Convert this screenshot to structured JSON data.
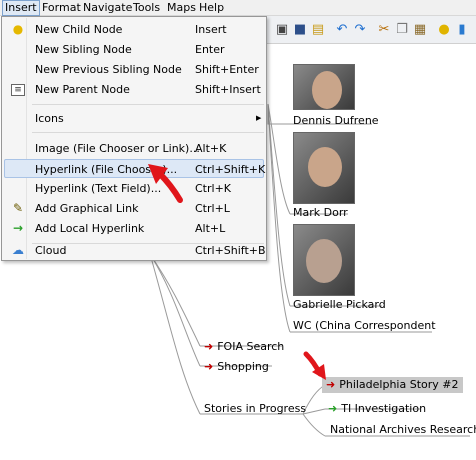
{
  "menubar": {
    "items": [
      "Insert",
      "Format",
      "Navigate",
      "Tools",
      "Maps",
      "Help"
    ]
  },
  "dropdown": {
    "items": [
      {
        "label": "New Child Node",
        "shortcut": "Insert",
        "icon": "lightbulb-icon"
      },
      {
        "label": "New Sibling Node",
        "shortcut": "Enter",
        "icon": ""
      },
      {
        "label": "New Previous Sibling Node",
        "shortcut": "Shift+Enter",
        "icon": ""
      },
      {
        "label": "New Parent Node",
        "shortcut": "Shift+Insert",
        "icon": "parent-node-icon"
      },
      {
        "label": "Icons",
        "shortcut": "",
        "icon": "",
        "submenu": true
      },
      {
        "label": "Image (File Chooser or Link)...",
        "shortcut": "Alt+K",
        "icon": ""
      },
      {
        "label": "Hyperlink (File Chooser)...",
        "shortcut": "Ctrl+Shift+K",
        "icon": "",
        "highlighted": true
      },
      {
        "label": "Hyperlink (Text Field)...",
        "shortcut": "Ctrl+K",
        "icon": ""
      },
      {
        "label": "Add Graphical Link",
        "shortcut": "Ctrl+L",
        "icon": "graphical-link-icon"
      },
      {
        "label": "Add Local Hyperlink",
        "shortcut": "Alt+L",
        "icon": "green-arrow-icon"
      },
      {
        "label": "Cloud",
        "shortcut": "Ctrl+Shift+B",
        "icon": "cloud-icon"
      }
    ],
    "submenu_arrow": "▶"
  },
  "mindmap": {
    "people": [
      {
        "name": "Dennis Dufrene"
      },
      {
        "name": "Mark Dorr"
      },
      {
        "name": "Gabrielle Pickard"
      }
    ],
    "wc_node": "WC (China Correspondent",
    "foia": "FOIA Search",
    "shopping": "Shopping",
    "stories": "Stories in Progress",
    "philly": "Philadelphia Story #2",
    "ti": "TI Investigation",
    "archives": "National Archives Research",
    "link_arrow": "➜"
  },
  "colors": {
    "callout_red": "#e0161b",
    "edge_gray": "#9a9a9a",
    "highlight": "#dde8f6"
  }
}
